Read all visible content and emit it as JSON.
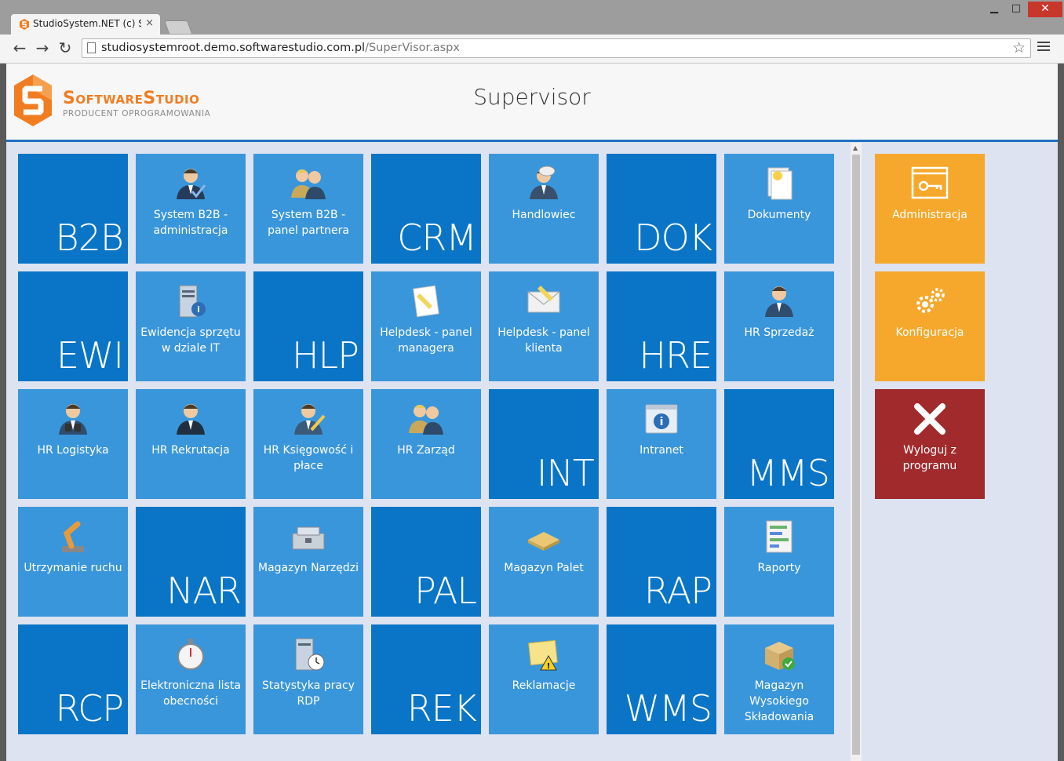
{
  "browser": {
    "tab_title": "StudioSystem.NET (c) Soft",
    "tab_close": "×",
    "url_host": "studiosystemroot.demo.softwarestudio.com.pl",
    "url_path": "/SuperVisor.aspx",
    "back": "←",
    "forward": "→",
    "reload": "↻",
    "star": "☆",
    "min": "▁",
    "max": "□",
    "close": "✕"
  },
  "header": {
    "logo_name": "SoftwareStudio",
    "logo_sub": "PRODUCENT OPROGRAMOWANIA",
    "title": "Supervisor"
  },
  "colors": {
    "dark_tile": "#0a75c7",
    "light_tile": "#3a96db",
    "orange": "#f5a82c",
    "red": "#a12a2d",
    "accent": "#1f71bf"
  },
  "tiles": [
    {
      "code": "B2B"
    },
    {
      "label": "System B2B - administracja",
      "icon": "admin-user-icon"
    },
    {
      "label": "System B2B - panel partnera",
      "icon": "users-icon"
    },
    {
      "code": "CRM"
    },
    {
      "label": "Handlowiec",
      "icon": "salesman-icon"
    },
    {
      "code": "DOK"
    },
    {
      "label": "Dokumenty",
      "icon": "document-icon"
    },
    {
      "code": "EWI"
    },
    {
      "label": "Ewidencja sprzętu w dziale IT",
      "icon": "server-info-icon"
    },
    {
      "code": "HLP"
    },
    {
      "label": "Helpdesk - panel managera",
      "icon": "note-icon"
    },
    {
      "label": "Helpdesk - panel klienta",
      "icon": "mail-icon"
    },
    {
      "code": "HRE"
    },
    {
      "label": "HR Sprzedaż",
      "icon": "user-icon"
    },
    {
      "label": "HR Logistyka",
      "icon": "binoculars-user-icon"
    },
    {
      "label": "HR Rekrutacja",
      "icon": "recruiter-icon"
    },
    {
      "label": "HR Księgowość i płace",
      "icon": "accountant-icon"
    },
    {
      "label": "HR Zarząd",
      "icon": "board-icon"
    },
    {
      "code": "INT"
    },
    {
      "label": "Intranet",
      "icon": "info-window-icon"
    },
    {
      "code": "MMS"
    },
    {
      "label": "Utrzymanie ruchu",
      "icon": "robot-arm-icon"
    },
    {
      "code": "NAR"
    },
    {
      "label": "Magazyn Narzędzi",
      "icon": "toolbox-icon"
    },
    {
      "code": "PAL"
    },
    {
      "label": "Magazyn Palet",
      "icon": "pallet-icon"
    },
    {
      "code": "RAP"
    },
    {
      "label": "Raporty",
      "icon": "report-icon"
    },
    {
      "code": "RCP"
    },
    {
      "label": "Elektroniczna lista obecności",
      "icon": "stopwatch-icon"
    },
    {
      "label": "Statystyka pracy RDP",
      "icon": "server-clock-icon"
    },
    {
      "code": "REK"
    },
    {
      "label": "Reklamacje",
      "icon": "warning-note-icon"
    },
    {
      "code": "WMS"
    },
    {
      "label": "Magazyn Wysokiego Składowania",
      "icon": "box-check-icon"
    }
  ],
  "side": [
    {
      "label": "Administracja",
      "icon": "admin-window-key-icon"
    },
    {
      "label": "Konfiguracja",
      "icon": "gears-icon"
    },
    {
      "label": "Wyloguj z programu",
      "icon": "close-x-icon"
    }
  ]
}
